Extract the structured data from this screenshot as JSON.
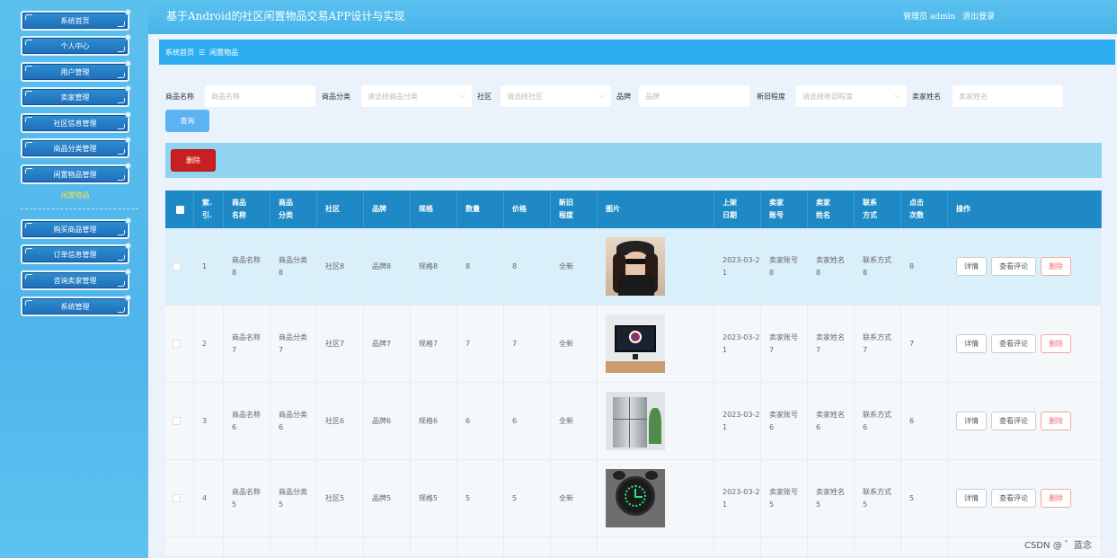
{
  "header": {
    "title": "基于Android的社区闲置物品交易APP设计与实现",
    "admin": "管理员 admin",
    "logout": "退出登录"
  },
  "sidebar": {
    "items": [
      {
        "label": "系统首页"
      },
      {
        "label": "个人中心"
      },
      {
        "label": "用户管理"
      },
      {
        "label": "卖家管理"
      },
      {
        "label": "社区信息管理"
      },
      {
        "label": "商品分类管理"
      },
      {
        "label": "闲置物品管理"
      },
      {
        "label": "购买商品管理"
      },
      {
        "label": "订单信息管理"
      },
      {
        "label": "咨询卖家管理"
      },
      {
        "label": "系统管理"
      }
    ],
    "active_sub": "闲置物品"
  },
  "breadcrumb": {
    "home": "系统首页",
    "sep": "☰",
    "current": "闲置物品"
  },
  "filters": {
    "name": {
      "label": "商品名称",
      "placeholder": "商品名称"
    },
    "category": {
      "label": "商品分类",
      "placeholder": "请选择商品分类"
    },
    "community": {
      "label": "社区",
      "placeholder": "请选择社区"
    },
    "brand": {
      "label": "品牌",
      "placeholder": "品牌"
    },
    "condition": {
      "label": "新旧程度",
      "placeholder": "请选择新旧程度"
    },
    "seller": {
      "label": "卖家姓名",
      "placeholder": "卖家姓名"
    },
    "search_label": "查询"
  },
  "toolbar": {
    "delete_label": "删除"
  },
  "table": {
    "headers": [
      "索.引.",
      "商品名称",
      "商品分类",
      "社区",
      "品牌",
      "规格",
      "数量",
      "价格",
      "新旧程度",
      "图片",
      "上架日期",
      "卖家账号",
      "卖家姓名",
      "联系方式",
      "点击次数",
      "操作"
    ],
    "header_lines": [
      [
        "索.",
        "引."
      ],
      [
        "商品",
        "名称"
      ],
      [
        "商品",
        "分类"
      ],
      [
        "社区"
      ],
      [
        "品牌"
      ],
      [
        "规格"
      ],
      [
        "数量"
      ],
      [
        "价格"
      ],
      [
        "新旧",
        "程度"
      ],
      [
        "图片"
      ],
      [
        "上架",
        "日期"
      ],
      [
        "卖家",
        "账号"
      ],
      [
        "卖家",
        "姓名"
      ],
      [
        "联系",
        "方式"
      ],
      [
        "点击",
        "次数"
      ],
      [
        "操作"
      ]
    ],
    "rows": [
      {
        "idx": "1",
        "name": [
          "商品名称",
          "8"
        ],
        "cat": [
          "商品分类",
          "8"
        ],
        "community": "社区8",
        "brand": "品牌8",
        "spec": "规格8",
        "qty": "8",
        "price": "8",
        "cond": "全新",
        "image": "woman-portrait",
        "date": [
          "2023-03-2",
          "1"
        ],
        "acct": [
          "卖家账号",
          "8"
        ],
        "sname": [
          "卖家姓名",
          "8"
        ],
        "contact": [
          "联系方式",
          "8"
        ],
        "clicks": "8"
      },
      {
        "idx": "2",
        "name": [
          "商品名称",
          "7"
        ],
        "cat": [
          "商品分类",
          "7"
        ],
        "community": "社区7",
        "brand": "品牌7",
        "spec": "规格7",
        "qty": "7",
        "price": "7",
        "cond": "全新",
        "image": "monitor",
        "date": [
          "2023-03-2",
          "1"
        ],
        "acct": [
          "卖家账号",
          "7"
        ],
        "sname": [
          "卖家姓名",
          "7"
        ],
        "contact": [
          "联系方式",
          "7"
        ],
        "clicks": "7"
      },
      {
        "idx": "3",
        "name": [
          "商品名称",
          "6"
        ],
        "cat": [
          "商品分类",
          "6"
        ],
        "community": "社区6",
        "brand": "品牌6",
        "spec": "规格6",
        "qty": "6",
        "price": "6",
        "cond": "全新",
        "image": "refrigerator",
        "date": [
          "2023-03-2",
          "1"
        ],
        "acct": [
          "卖家账号",
          "6"
        ],
        "sname": [
          "卖家姓名",
          "6"
        ],
        "contact": [
          "联系方式",
          "6"
        ],
        "clicks": "6"
      },
      {
        "idx": "4",
        "name": [
          "商品名称",
          "5"
        ],
        "cat": [
          "商品分类",
          "5"
        ],
        "community": "社区5",
        "brand": "品牌5",
        "spec": "规格5",
        "qty": "5",
        "price": "5",
        "cond": "全新",
        "image": "alarm-clock",
        "date": [
          "2023-03-2",
          "1"
        ],
        "acct": [
          "卖家账号",
          "5"
        ],
        "sname": [
          "卖家姓名",
          "5"
        ],
        "contact": [
          "联系方式",
          "5"
        ],
        "clicks": "5"
      }
    ],
    "actions": {
      "detail": "详情",
      "comments": "查看评论",
      "delete": "删除"
    }
  },
  "watermark": "CSDN @ ゛蓝念",
  "colors": {
    "header": "#46b4ea",
    "breadcrumb": "#2eaef0",
    "table_head": "#1e89c4",
    "toolbar": "#91d4f1",
    "delete": "#c82020",
    "search": "#5cb3f4",
    "highlight_row": "#d9eff9"
  }
}
